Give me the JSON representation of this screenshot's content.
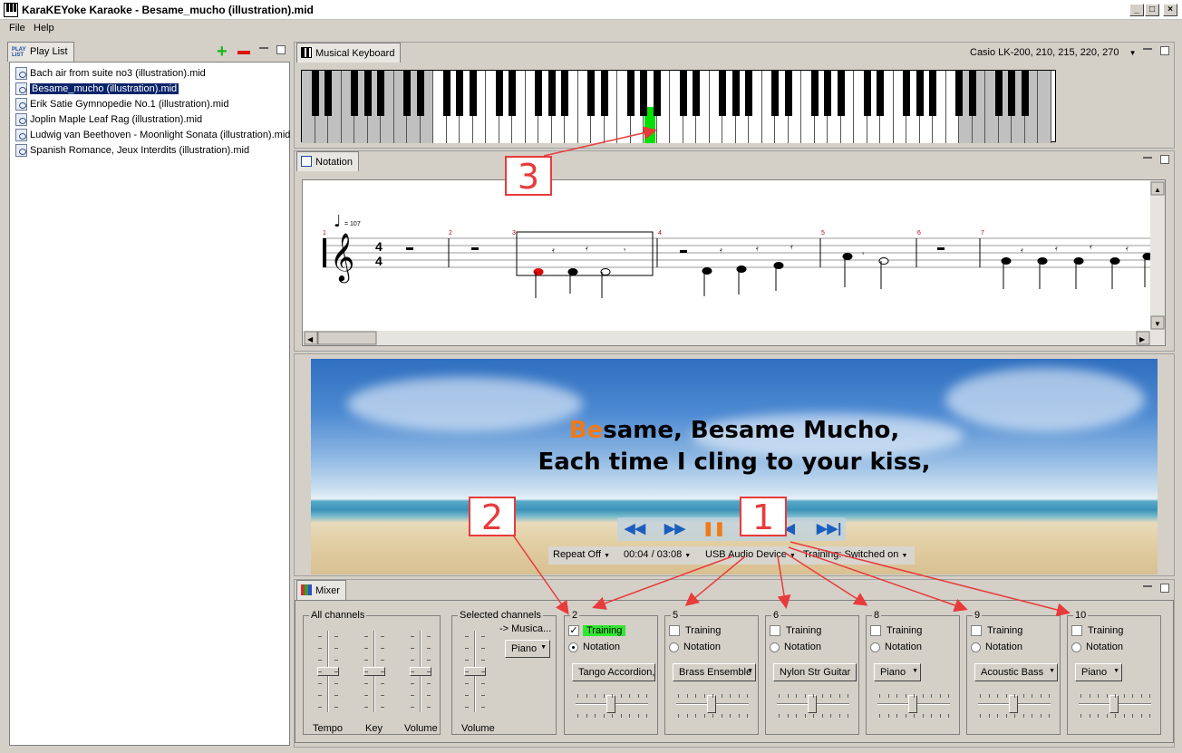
{
  "window": {
    "title": "KaraKEYoke Karaoke - Besame_mucho (illustration).mid"
  },
  "menu": {
    "file": "File",
    "help": "Help"
  },
  "playlist": {
    "tab_label": "Play List",
    "icon_text": "PLAY LIST",
    "items": [
      "Bach air from suite no3 (illustration).mid",
      "Besame_mucho (illustration).mid",
      "Erik Satie Gymnopedie No.1 (illustration).mid",
      "Joplin Maple Leaf Rag (illustration).mid",
      "Ludwig van Beethoven - Moonlight Sonata (illustration).mid",
      "Spanish Romance, Jeux Interdits (illustration).mid"
    ],
    "selected_index": 1
  },
  "keyboard": {
    "tab_label": "Musical Keyboard",
    "model": "Casio LK-200, 210, 215, 220, 270",
    "active_key_color": "#00e000"
  },
  "notation": {
    "tab_label": "Notation",
    "tempo": "= 107",
    "time_sig_top": "4",
    "time_sig_bottom": "4",
    "measures": [
      "1",
      "2",
      "3",
      "4",
      "5",
      "6",
      "7"
    ]
  },
  "karaoke": {
    "line1_highlight": "Be",
    "line1_rest": "same, Besame Mucho,",
    "line2": "Each time I cling to your kiss,",
    "repeat": "Repeat Off",
    "time": "00:04 / 03:08",
    "device": "USB Audio Device",
    "training": "Training: Switched on"
  },
  "mixer": {
    "tab_label": "Mixer",
    "all_channels": {
      "label": "All channels",
      "sliders": [
        "Tempo",
        "Key",
        "Volume"
      ]
    },
    "selected_channels": {
      "label": "Selected channels",
      "target": "-> Musica...",
      "instrument": "Piano",
      "slider": "Volume"
    },
    "training_label": "Training",
    "notation_label": "Notation",
    "channels": [
      {
        "number": "2",
        "training": true,
        "notation": true,
        "instrument": "Tango Accordion,"
      },
      {
        "number": "5",
        "training": false,
        "notation": false,
        "instrument": "Brass Ensemble"
      },
      {
        "number": "6",
        "training": false,
        "notation": false,
        "instrument": "Nylon Str Guitar"
      },
      {
        "number": "8",
        "training": false,
        "notation": false,
        "instrument": "Piano"
      },
      {
        "number": "9",
        "training": false,
        "notation": false,
        "instrument": "Acoustic Bass"
      },
      {
        "number": "10",
        "training": false,
        "notation": false,
        "instrument": "Piano"
      }
    ]
  },
  "callouts": {
    "one": "1",
    "two": "2",
    "three": "3"
  },
  "colors": {
    "accent": "#e83b3b",
    "highlight": "#f07a17",
    "selection": "#0a246a"
  }
}
